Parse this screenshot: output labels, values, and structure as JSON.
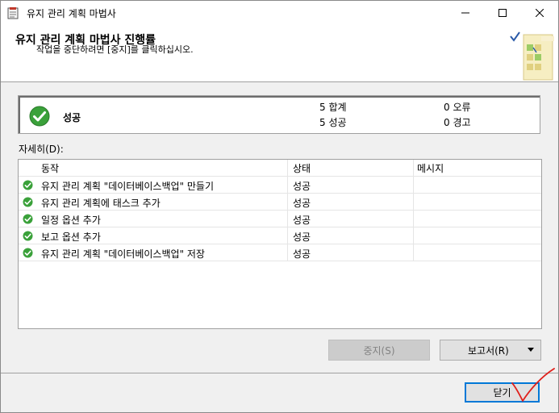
{
  "window": {
    "title": "유지 관리 계획 마법사",
    "controls": {
      "minimize": "minimize",
      "maximize": "maximize",
      "close": "close"
    }
  },
  "header": {
    "title": "유지 관리 계획 마법사 진행률",
    "subtitle": "작업을 중단하려면 [중지]를 클릭하십시오."
  },
  "status": {
    "label": "성공",
    "total": "5 합계",
    "success": "5 성공",
    "errors": "0 오류",
    "warnings": "0 경고"
  },
  "details": {
    "label": "자세히(D):",
    "columns": [
      "동작",
      "상태",
      "메시지"
    ],
    "rows": [
      {
        "action": "유지 관리 계획 \"데이터베이스백업\" 만들기",
        "status": "성공",
        "message": ""
      },
      {
        "action": "유지 관리 계획에 태스크 추가",
        "status": "성공",
        "message": ""
      },
      {
        "action": "일정 옵션 추가",
        "status": "성공",
        "message": ""
      },
      {
        "action": "보고 옵션 추가",
        "status": "성공",
        "message": ""
      },
      {
        "action": "유지 관리 계획 \"데이터베이스백업\" 저장",
        "status": "성공",
        "message": ""
      }
    ]
  },
  "buttons": {
    "stop": "중지(S)",
    "report": "보고서(R)",
    "close": "닫기"
  },
  "colors": {
    "success_green": "#3aa13a",
    "focus_blue": "#0078d7",
    "annotation_red": "#e0201b"
  }
}
